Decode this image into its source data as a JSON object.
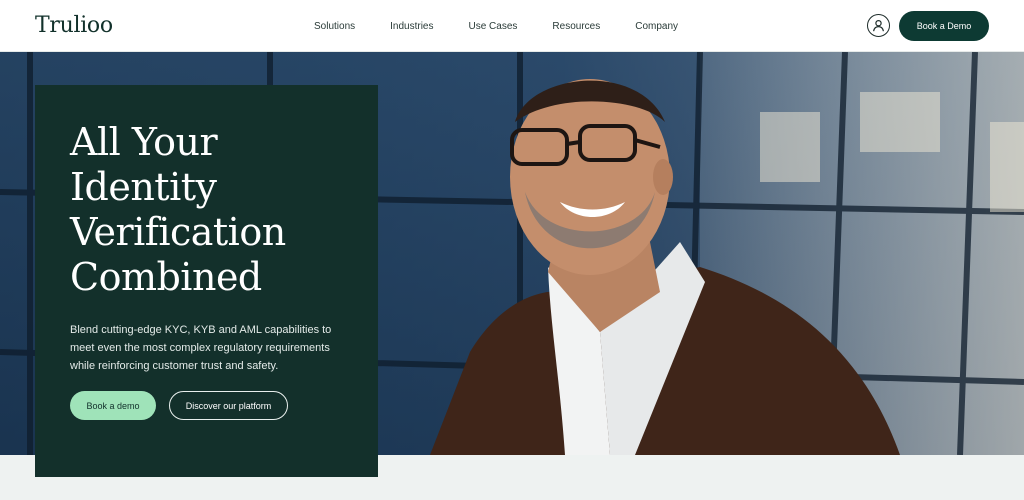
{
  "header": {
    "logo": "Trulioo",
    "nav": [
      "Solutions",
      "Industries",
      "Use Cases",
      "Resources",
      "Company"
    ],
    "book_demo_label": "Book a Demo"
  },
  "hero": {
    "headline": [
      "All Your",
      "Identity",
      "Verification",
      "Combined"
    ],
    "subtitle": "Blend cutting-edge KYC, KYB and AML capabilities to meet even the most complex regulatory requirements while reinforcing customer trust and safety.",
    "primary_cta": "Book a demo",
    "secondary_cta": "Discover our platform"
  },
  "icons": {
    "account": "user-icon"
  },
  "colors": {
    "brand_dark": "#0d3a33",
    "card_bg": "#13302b",
    "accent_mint": "#9fe3b9",
    "page_bg": "#eef2f1"
  }
}
